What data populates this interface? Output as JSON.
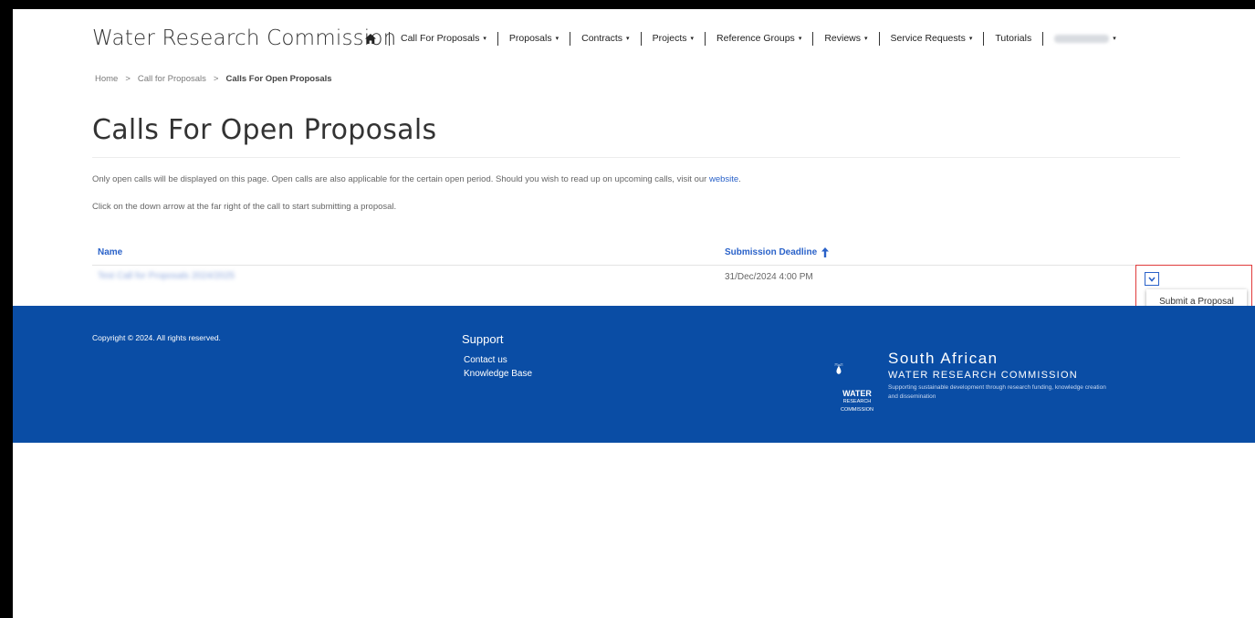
{
  "header": {
    "brand": "Water Research Commission",
    "nav": [
      {
        "label": "Call For Proposals",
        "caret": "▾"
      },
      {
        "label": "Proposals",
        "caret": "▾"
      },
      {
        "label": "Contracts",
        "caret": "▾"
      },
      {
        "label": "Projects",
        "caret": "▾"
      },
      {
        "label": "Reference Groups",
        "caret": "▾"
      },
      {
        "label": "Reviews",
        "caret": "▾"
      },
      {
        "label": "Service Requests",
        "caret": "▾"
      },
      {
        "label": "Tutorials",
        "caret": ""
      }
    ],
    "user_caret": "▾"
  },
  "breadcrumb": {
    "home": "Home",
    "sep": ">",
    "parent": "Call for Proposals",
    "current": "Calls For Open Proposals"
  },
  "page": {
    "title": "Calls For Open Proposals",
    "intro_text": "Only open calls will be displayed on this page. Open calls are also applicable for the certain open period. Should you wish to read up on upcoming calls, visit our ",
    "intro_link": "website",
    "intro_end": ".",
    "instruction": "Click on the down arrow at the far right of the call to start submitting a proposal."
  },
  "table": {
    "headers": {
      "name": "Name",
      "deadline": "Submission Deadline"
    },
    "rows": [
      {
        "name": "Test Call for Proposals 2024/2025",
        "deadline": "31/Dec/2024 4:00 PM"
      }
    ],
    "row_menu": {
      "item": "Submit a Proposal"
    }
  },
  "footer": {
    "copyright": "Copyright © 2024. All rights reserved.",
    "support_title": "Support",
    "links": [
      "Contact us",
      "Knowledge Base"
    ],
    "logo": {
      "line1": "South African",
      "line2": "WATER RESEARCH COMMISSION",
      "line3": "Supporting sustainable development through research funding, knowledge creation and dissemination",
      "badge1": "WATER",
      "badge2": "RESEARCH",
      "badge3": "COMMISSION"
    }
  },
  "colors": {
    "accent": "#2a62c9",
    "footer_bg": "#0a4da5",
    "highlight": "#e03b3b"
  }
}
